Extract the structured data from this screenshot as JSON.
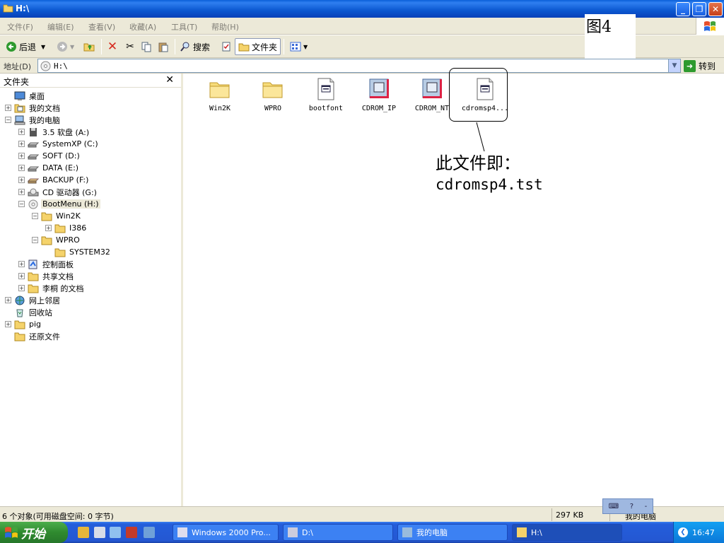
{
  "window": {
    "title": "H:\\"
  },
  "figure_label": "图4",
  "menu": [
    {
      "label": "文件(F)"
    },
    {
      "label": "编辑(E)"
    },
    {
      "label": "查看(V)"
    },
    {
      "label": "收藏(A)"
    },
    {
      "label": "工具(T)"
    },
    {
      "label": "帮助(H)"
    }
  ],
  "toolbar": {
    "back": "后退",
    "search": "搜索",
    "folders": "文件夹"
  },
  "address": {
    "label": "地址(D)",
    "value": "H:\\",
    "go": "转到"
  },
  "folders_pane": {
    "title": "文件夹",
    "items": [
      {
        "label": "桌面",
        "expander": ""
      },
      {
        "label": "我的文档",
        "expander": "+"
      },
      {
        "label": "我的电脑",
        "expander": "−"
      },
      {
        "label": "3.5 软盘 (A:)",
        "expander": "+"
      },
      {
        "label": "SystemXP (C:)",
        "expander": "+"
      },
      {
        "label": "SOFT (D:)",
        "expander": "+"
      },
      {
        "label": "DATA (E:)",
        "expander": "+"
      },
      {
        "label": "BACKUP (F:)",
        "expander": "+"
      },
      {
        "label": "CD 驱动器 (G:)",
        "expander": "+"
      },
      {
        "label": "BootMenu (H:)",
        "expander": "−"
      },
      {
        "label": "Win2K",
        "expander": "−"
      },
      {
        "label": "I386",
        "expander": "+"
      },
      {
        "label": "WPRO",
        "expander": "−"
      },
      {
        "label": "SYSTEM32",
        "expander": ""
      },
      {
        "label": "控制面板",
        "expander": "+"
      },
      {
        "label": "共享文档",
        "expander": "+"
      },
      {
        "label": "李桐 的文档",
        "expander": "+"
      },
      {
        "label": "网上邻居",
        "expander": "+"
      },
      {
        "label": "回收站",
        "expander": ""
      },
      {
        "label": "pig",
        "expander": "+"
      },
      {
        "label": "还原文件",
        "expander": ""
      }
    ]
  },
  "files": [
    {
      "name": "Win2K",
      "icon": "folder-icon"
    },
    {
      "name": "WPRO",
      "icon": "folder-icon"
    },
    {
      "name": "bootfont",
      "icon": "document-icon"
    },
    {
      "name": "CDROM_IP",
      "icon": "system-file-icon"
    },
    {
      "name": "CDROM_NT",
      "icon": "system-file-icon"
    },
    {
      "name": "cdromsp4...",
      "icon": "document-icon"
    }
  ],
  "annotation": {
    "line1": "此文件即：",
    "line2": "cdromsp4.tst"
  },
  "status": {
    "objects": "6 个对象(可用磁盘空间: 0 字节)",
    "size": "297 KB",
    "location": "我的电脑"
  },
  "taskbar": {
    "start": "开始",
    "tasks": [
      {
        "label": "Windows 2000 Pro..."
      },
      {
        "label": "D:\\"
      },
      {
        "label": "我的电脑"
      },
      {
        "label": "H:\\"
      }
    ],
    "clock": "16:47"
  },
  "colors": {
    "titlebar": "#0b57d0",
    "taskbar": "#2457d2",
    "start": "#2f8a2f",
    "chrome": "#ece9d8"
  }
}
